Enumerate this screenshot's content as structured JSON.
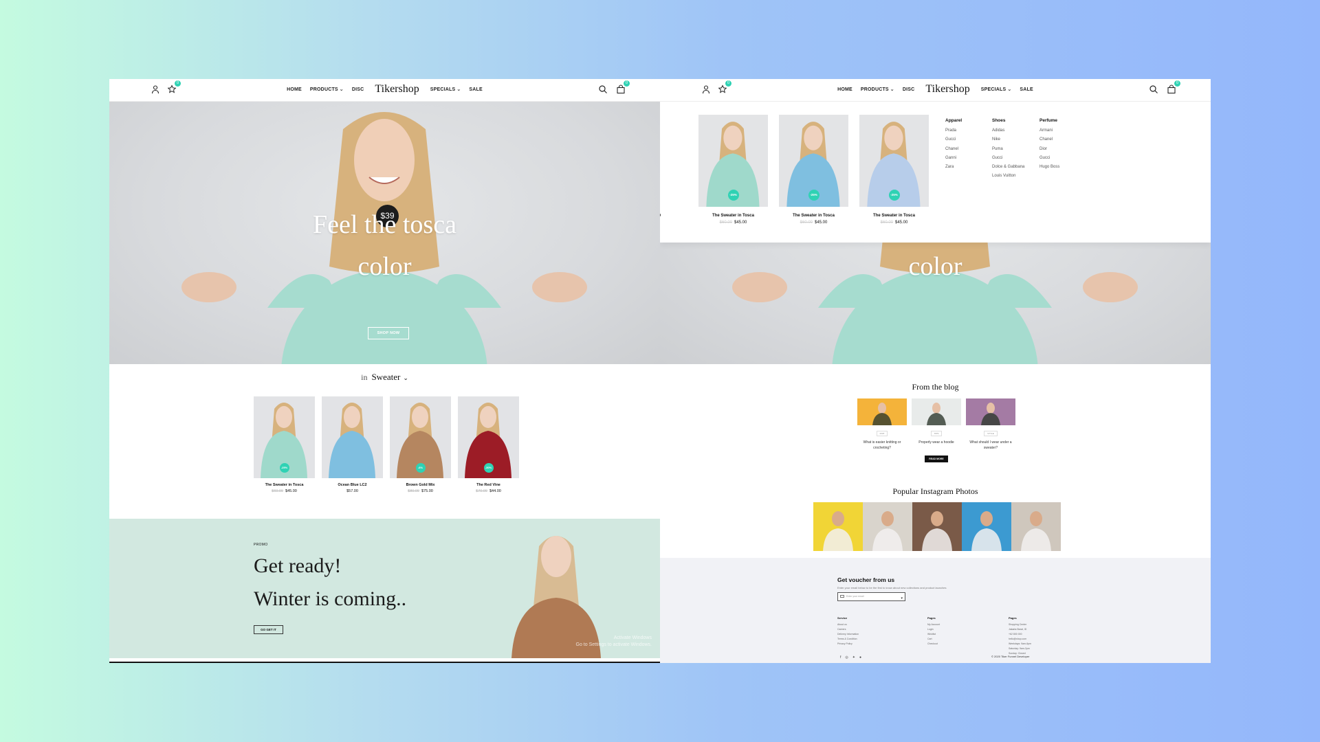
{
  "nav": {
    "items_left": [
      "HOME",
      "PRODUCTS",
      "DISC"
    ],
    "logo": "Tikershop",
    "items_right": [
      "SPECIALS",
      "SALE"
    ],
    "wishlist_count": "0",
    "cart_count": "0"
  },
  "hero": {
    "price": "$39",
    "title_line1": "Feel the tosca",
    "title_line2": "color",
    "button": "SHOP NOW"
  },
  "category": {
    "prefix": "in",
    "name": "Sweater"
  },
  "products": [
    {
      "name": "The Sweater in Tosca",
      "old_price": "$60.00",
      "price": "$45.00",
      "discount": "-25%",
      "color": "#9fd9cb"
    },
    {
      "name": "Ocean Blue LC2",
      "old_price": "",
      "price": "$57.00",
      "discount": "",
      "color": "#7fbfe0"
    },
    {
      "name": "Brown Gold Mix",
      "old_price": "$80.00",
      "price": "$75.00",
      "discount": "-6%",
      "color": "#b58660"
    },
    {
      "name": "The Red Vine",
      "old_price": "$70.00",
      "price": "$44.00",
      "discount": "-30%",
      "color": "#9c1c26"
    }
  ],
  "promo": {
    "label": "PROMO",
    "line1": "Get ready!",
    "line2": "Winter is coming..",
    "button": "GO GET IT",
    "watermark1": "Activate Windows",
    "watermark2": "Go to Settings to activate Windows."
  },
  "mega": {
    "products": [
      {
        "name": "The Sweater in Tosca",
        "old_price": "$60.00",
        "price": "$45.00",
        "discount": "-25%",
        "color": "#9fd9cb"
      },
      {
        "name": "The Sweater in Tosca",
        "old_price": "$60.00",
        "price": "$45.00",
        "discount": "-25%",
        "color": "#7fbfe0"
      },
      {
        "name": "The Sweater in Tosca",
        "old_price": "$60.00",
        "price": "$45.00",
        "discount": "-25%",
        "color": "#b7cdea"
      }
    ],
    "columns": [
      {
        "title": "Apparel",
        "items": [
          "Prada",
          "Gucci",
          "Chanel",
          "Ganni",
          "Zara"
        ]
      },
      {
        "title": "Shoes",
        "items": [
          "Adidas",
          "Nike",
          "Puma",
          "Gucci",
          "Dolce & Gabbana",
          "Louis Vuitton"
        ]
      },
      {
        "title": "Perfume",
        "items": [
          "Armani",
          "Chanel",
          "Dior",
          "Gucci",
          "Hugo Boss"
        ]
      }
    ]
  },
  "blog": {
    "title": "From the blog",
    "posts": [
      {
        "tag": "KNIT",
        "title": "What is easier knitting or crocheting?",
        "bg": "#f4b33a"
      },
      {
        "tag": "TIPS",
        "title": "Properly wear a hoodie",
        "bg": "#e8ebea"
      },
      {
        "tag": "STYLE",
        "title": "What should I wear under a sweater?",
        "bg": "#a47ba4"
      }
    ],
    "button": "READ MORE"
  },
  "instagram": {
    "title": "Popular Instagram Photos",
    "photos": [
      "#f1d536",
      "#d9d4cc",
      "#7a5a48",
      "#3c9ad1",
      "#cfc7bd"
    ]
  },
  "footer": {
    "voucher_title": "Get voucher from us",
    "voucher_sub": "Enter your email below to be the first to know about new collections and product launches",
    "email_placeholder": "Enter your email",
    "columns": [
      {
        "title": "Service",
        "items": [
          "About us",
          "Careers",
          "Delivery Information",
          "Terms & Condition",
          "Privacy Policy"
        ]
      },
      {
        "title": "Pages",
        "items": [
          "My Account",
          "Login",
          "Wishlist",
          "Cart",
          "Checkout"
        ]
      },
      {
        "title": "Pages",
        "items": [
          "Shopping Center",
          "Jakarta Barat, ID",
          "+62 800 000",
          "hello@shop.com",
          "Weekdays: 9am-6pm",
          "Saturday: 9am-2pm",
          "Sunday: Closed"
        ]
      }
    ],
    "copyright": "© 2020 Tiker Funnel Developer"
  },
  "colors": {
    "accent": "#2fd2b4",
    "promo_bg": "#d2e8e0",
    "footer_bg": "#f1f2f6"
  }
}
